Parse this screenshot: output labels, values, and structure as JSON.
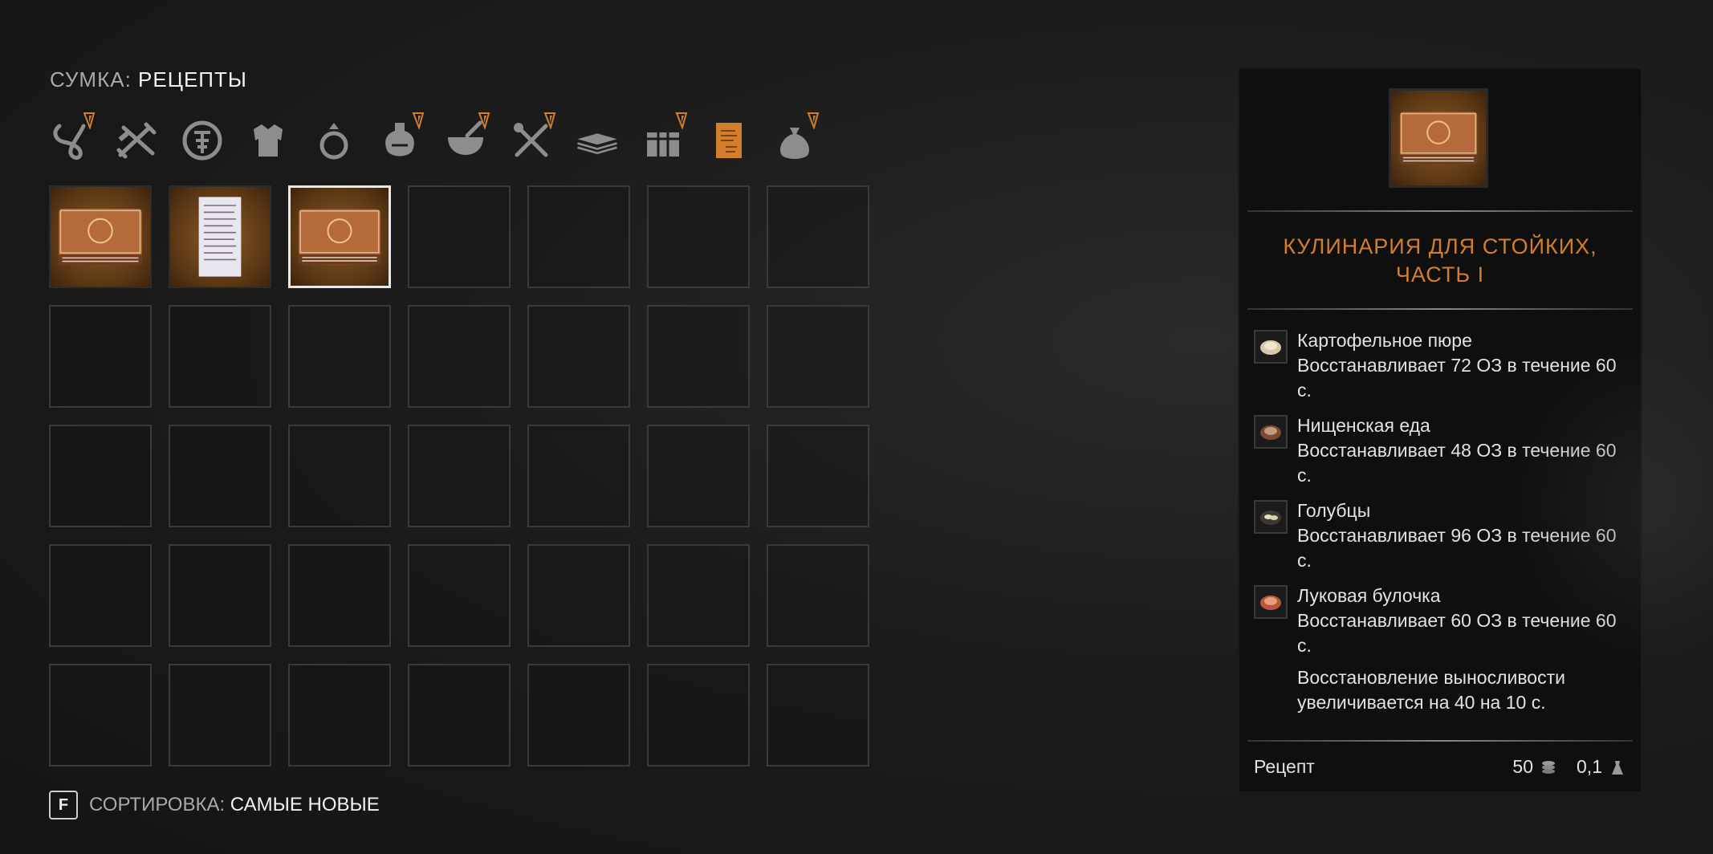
{
  "header": {
    "label": "СУМКА:",
    "value": "РЕЦЕПТЫ"
  },
  "categories": [
    {
      "icon": "rope-icon",
      "has_new": true
    },
    {
      "icon": "crossed-weapons-icon",
      "has_new": false
    },
    {
      "icon": "emblem-icon",
      "has_new": false
    },
    {
      "icon": "armor-icon",
      "has_new": false
    },
    {
      "icon": "ring-icon",
      "has_new": false
    },
    {
      "icon": "potion-icon",
      "has_new": true
    },
    {
      "icon": "mortar-icon",
      "has_new": true
    },
    {
      "icon": "tools-icon",
      "has_new": true
    },
    {
      "icon": "books-icon",
      "has_new": false
    },
    {
      "icon": "chest-icon",
      "has_new": true
    },
    {
      "icon": "recipe-scroll-icon",
      "has_new": false,
      "active": true
    },
    {
      "icon": "sack-icon",
      "has_new": true
    }
  ],
  "grid": {
    "items": [
      {
        "icon": "book-icon",
        "selected": false
      },
      {
        "icon": "scroll-icon",
        "selected": false
      },
      {
        "icon": "book-icon",
        "selected": true
      }
    ]
  },
  "sort": {
    "key": "F",
    "label": "СОРТИРОВКА:",
    "value": "САМЫЕ НОВЫЕ"
  },
  "detail": {
    "title_line1": "КУЛИНАРИЯ ДЛЯ СТОЙКИХ,",
    "title_line2": "ЧАСТЬ I",
    "effects": [
      {
        "name": "Картофельное пюре",
        "desc": "Восстанавливает 72 ОЗ в течение 60 с.",
        "icon": "mashed-potato-icon"
      },
      {
        "name": "Нищенская еда",
        "desc": "Восстанавливает 48 ОЗ в течение 60 с.",
        "icon": "beggar-food-icon"
      },
      {
        "name": "Голубцы",
        "desc": "Восстанавливает 96 ОЗ в течение 60 с.",
        "icon": "cabbage-rolls-icon"
      },
      {
        "name": "Луковая булочка",
        "desc": "Восстанавливает 60 ОЗ в течение 60 с.",
        "icon": "onion-bun-icon"
      }
    ],
    "bonus": "Восстановление выносливости увеличивается на 40 на 10 с.",
    "footer": {
      "type": "Рецепт",
      "price": "50",
      "weight": "0,1"
    }
  },
  "colors": {
    "accent": "#d47e2c",
    "slot_border": "#3a3a3a",
    "panel_bg": "#0f0f0f"
  }
}
